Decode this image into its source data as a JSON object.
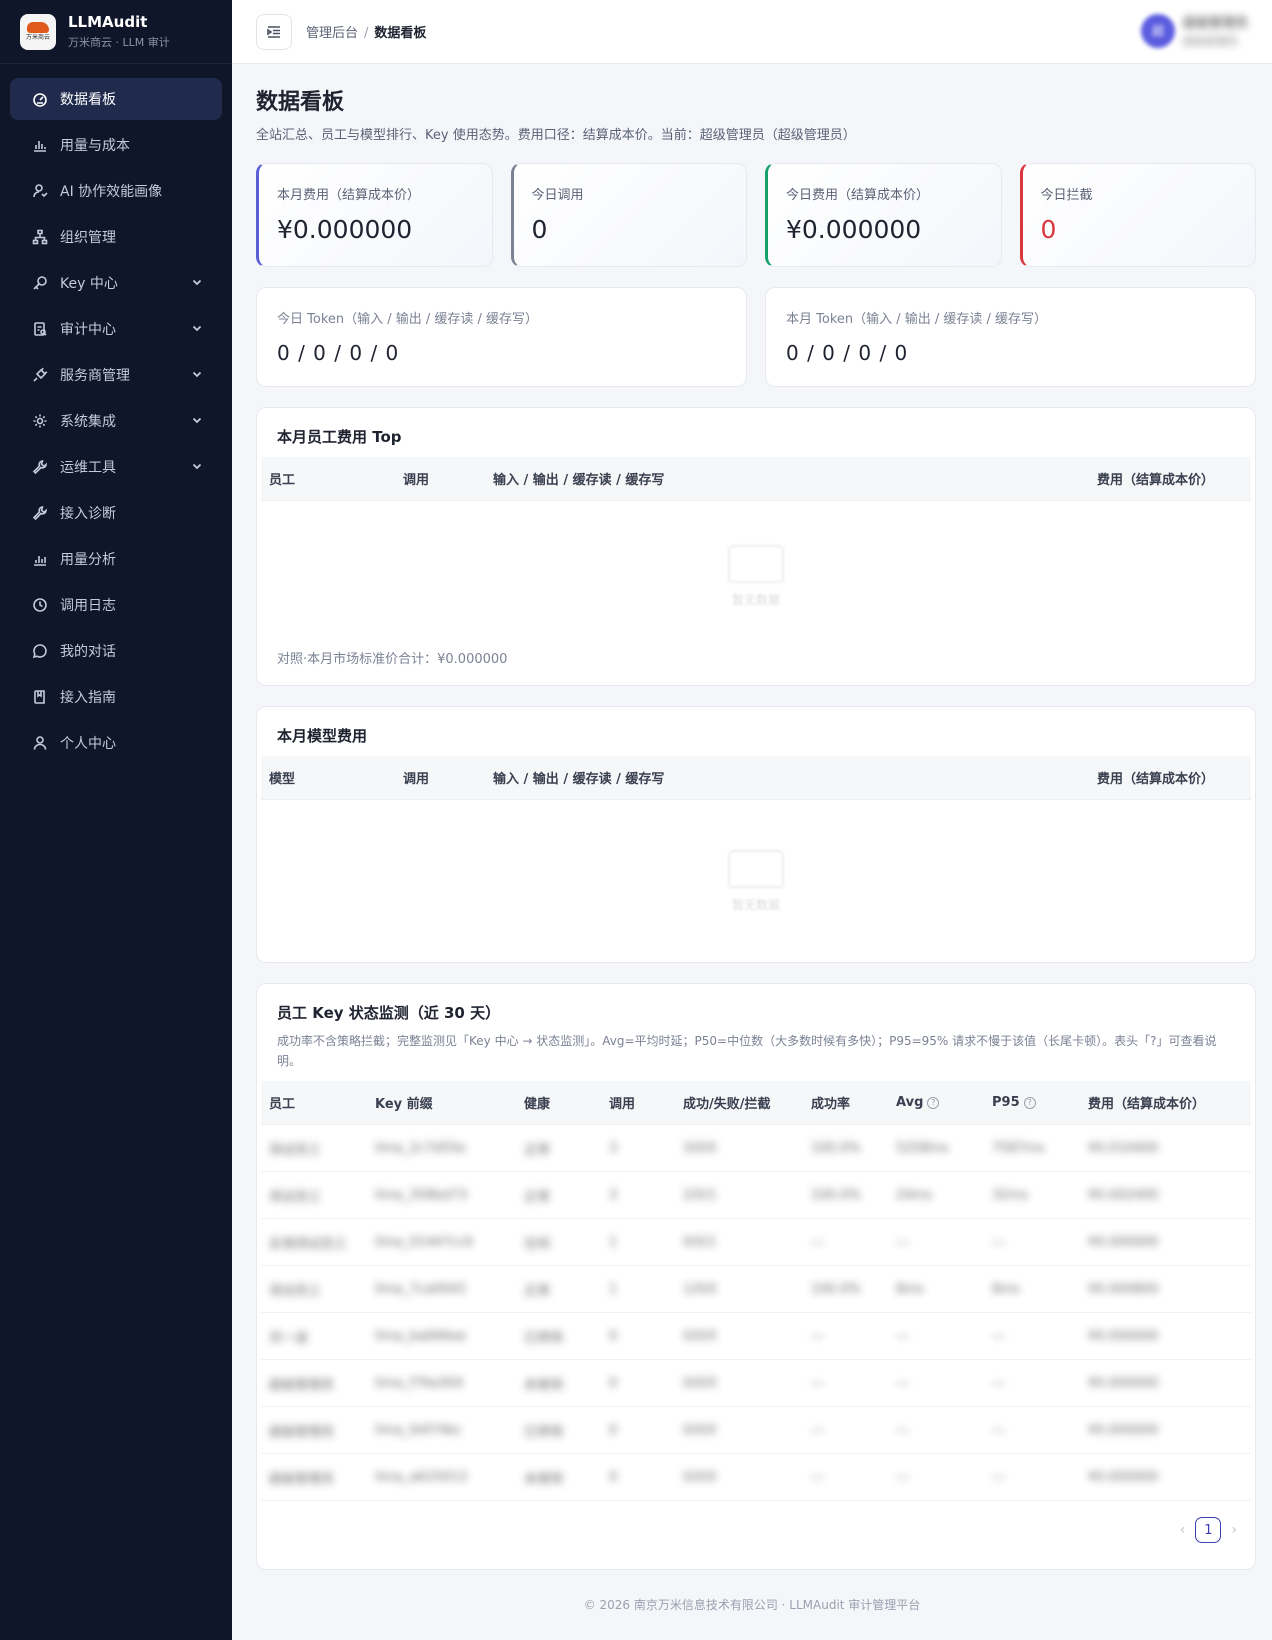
{
  "brand": {
    "title": "LLMAudit",
    "subtitle": "万米商云 · LLM 审计",
    "logo_text": "万米商云"
  },
  "sidebar": {
    "items": [
      {
        "label": "数据看板",
        "icon": "dashboard-icon",
        "active": true
      },
      {
        "label": "用量与成本",
        "icon": "bar-chart-icon"
      },
      {
        "label": "AI 协作效能画像",
        "icon": "user-profile-icon"
      },
      {
        "label": "组织管理",
        "icon": "org-tree-icon"
      },
      {
        "label": "Key 中心",
        "icon": "key-icon",
        "expandable": true
      },
      {
        "label": "审计中心",
        "icon": "audit-icon",
        "expandable": true
      },
      {
        "label": "服务商管理",
        "icon": "plug-icon",
        "expandable": true
      },
      {
        "label": "系统集成",
        "icon": "gear-icon",
        "expandable": true
      },
      {
        "label": "运维工具",
        "icon": "wrench-icon",
        "expandable": true
      },
      {
        "label": "接入诊断",
        "icon": "tool-icon"
      },
      {
        "label": "用量分析",
        "icon": "analysis-chart-icon"
      },
      {
        "label": "调用日志",
        "icon": "clock-icon"
      },
      {
        "label": "我的对话",
        "icon": "chat-icon"
      },
      {
        "label": "接入指南",
        "icon": "book-icon"
      },
      {
        "label": "个人中心",
        "icon": "user-icon"
      }
    ]
  },
  "header": {
    "breadcrumb_root": "管理后台",
    "breadcrumb_sep": "/",
    "breadcrumb_current": "数据看板",
    "user_avatar": "超",
    "user_name": "超级管理员",
    "user_role": "超级管理员"
  },
  "page": {
    "title": "数据看板",
    "description": "全站汇总、员工与模型排行、Key 使用态势。费用口径：结算成本价。当前：超级管理员（超级管理员）"
  },
  "stats": [
    {
      "label": "本月费用（结算成本价）",
      "value": "¥0.000000"
    },
    {
      "label": "今日调用",
      "value": "0"
    },
    {
      "label": "今日费用（结算成本价）",
      "value": "¥0.000000"
    },
    {
      "label": "今日拦截",
      "value": "0"
    }
  ],
  "tokens": [
    {
      "label": "今日 Token（输入 / 输出 / 缓存读 / 缓存写）",
      "value": "0 / 0 / 0 / 0"
    },
    {
      "label": "本月 Token（输入 / 输出 / 缓存读 / 缓存写）",
      "value": "0 / 0 / 0 / 0"
    }
  ],
  "employee_top": {
    "title": "本月员工费用 Top",
    "columns": [
      "员工",
      "调用",
      "输入 / 输出 / 缓存读 / 缓存写",
      "费用（结算成本价）"
    ],
    "empty_text": "暂无数据",
    "footnote": "对照·本月市场标准价合计：¥0.000000"
  },
  "model_cost": {
    "title": "本月模型费用",
    "columns": [
      "模型",
      "调用",
      "输入 / 输出 / 缓存读 / 缓存写",
      "费用（结算成本价）"
    ],
    "empty_text": "暂无数据"
  },
  "key_monitor": {
    "title": "员工 Key 状态监测（近 30 天）",
    "description": "成功率不含策略拦截；完整监测见「Key 中心 → 状态监测」。Avg=平均时延；P50=中位数（大多数时候有多快）；P95=95% 请求不慢于该值（长尾卡顿）。表头「?」可查看说明。",
    "columns": [
      "员工",
      "Key 前缀",
      "健康",
      "调用",
      "成功/失败/拦截",
      "成功率",
      "Avg",
      "P95",
      "费用（结算成本价）"
    ],
    "help_mark": "?",
    "rows": [
      [
        "测试员工",
        "llma_2c7d55e",
        "正常",
        "3",
        "3/0/0",
        "100.0%",
        "5258ms",
        "7587ms",
        "¥0.010400"
      ],
      [
        "测试员工",
        "llma_358bd73",
        "正常",
        "3",
        "2/0/1",
        "100.0%",
        "24ms",
        "32ms",
        "¥0.002400"
      ],
      [
        "反馈测试员工",
        "llma_01447cc6",
        "空闲",
        "1",
        "0/0/1",
        "—",
        "—",
        "—",
        "¥0.000000"
      ],
      [
        "测试员工",
        "llma_7ca0043",
        "正常",
        "1",
        "1/0/0",
        "100.0%",
        "8ms",
        "8ms",
        "¥0.000800"
      ],
      [
        "邓一波",
        "llma_ba666ee",
        "已停用",
        "0",
        "0/0/0",
        "—",
        "—",
        "—",
        "¥0.000000"
      ],
      [
        "超级管理员",
        "llma_f76a304",
        "未使用",
        "0",
        "0/0/0",
        "—",
        "—",
        "—",
        "¥0.000000"
      ],
      [
        "超级管理员",
        "llma_fe974bc",
        "已停用",
        "0",
        "0/0/0",
        "—",
        "—",
        "—",
        "¥0.000000"
      ],
      [
        "超级管理员",
        "llma_a625013",
        "未使用",
        "0",
        "0/0/0",
        "—",
        "—",
        "—",
        "¥0.000000"
      ]
    ],
    "pagination": {
      "current": "1",
      "prev": "‹",
      "next": "›"
    }
  },
  "footer": "© 2026 南京万米信息技术有限公司 · LLMAudit 审计管理平台"
}
